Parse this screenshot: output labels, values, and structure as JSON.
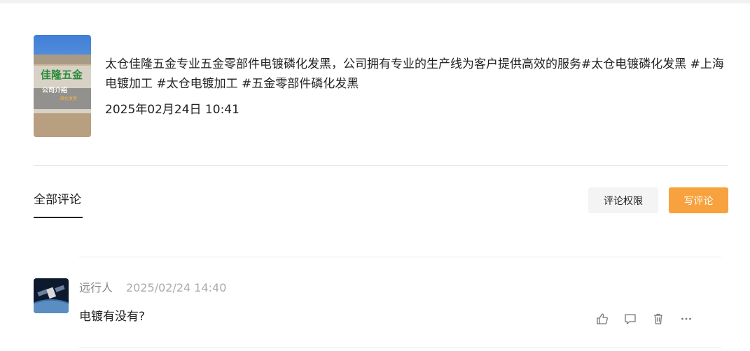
{
  "post": {
    "thumbnail_sign_text": "佳隆五金",
    "thumbnail_caption": "公司介绍",
    "thumbnail_sub": "磷化发黑",
    "description": "太仓佳隆五金专业五金零部件电镀磷化发黑，公司拥有专业的生产线为客户提供高效的服务#太仓电镀磷化发黑 #上海电镀加工 #太仓电镀加工 #五金零部件磷化发黑",
    "datetime": "2025年02月24日 10:41"
  },
  "comments_header": {
    "tab_all": "全部评论",
    "permission_button": "评论权限",
    "write_button": "写评论",
    "accent_color": "#f7a23e"
  },
  "comments": [
    {
      "user": "远行人",
      "date": "2025/02/24 14:40",
      "text": "电镀有没有?",
      "actions": [
        "thumbs-up-icon",
        "comment-icon",
        "trash-icon",
        "more-icon"
      ]
    }
  ]
}
